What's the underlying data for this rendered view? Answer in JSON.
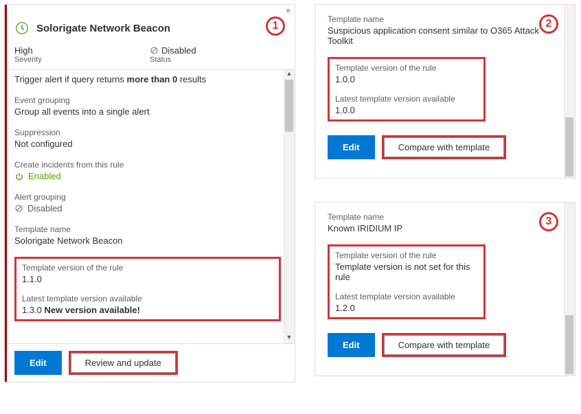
{
  "panel1": {
    "title": "Solorigate Network Beacon",
    "severity_value": "High",
    "severity_label": "Severity",
    "status_value": "Disabled",
    "status_label": "Status",
    "trigger_pre": "Trigger alert if query returns ",
    "trigger_bold": "more than 0",
    "trigger_post": " results",
    "grouping_label": "Event grouping",
    "grouping_value": "Group all events into a single alert",
    "suppression_label": "Suppression",
    "suppression_value": "Not configured",
    "incidents_label": "Create incidents from this rule",
    "incidents_value": "Enabled",
    "alertgrp_label": "Alert grouping",
    "alertgrp_value": "Disabled",
    "tplname_label": "Template name",
    "tplname_value": "Solorigate Network Beacon",
    "tplver_label": "Template version of the rule",
    "tplver_value": "1.1.0",
    "latest_label": "Latest template version available",
    "latest_ver": "1.3.0 ",
    "latest_bold": "New version available!",
    "edit_btn": "Edit",
    "review_btn": "Review and update"
  },
  "panel2": {
    "tplname_label": "Template name",
    "tplname_value": "Suspicious application consent similar to O365 Attack Toolkit",
    "tplver_label": "Template version of the rule",
    "tplver_value": "1.0.0",
    "latest_label": "Latest template version available",
    "latest_value": "1.0.0",
    "edit_btn": "Edit",
    "compare_btn": "Compare with template"
  },
  "panel3": {
    "tplname_label": "Template name",
    "tplname_value": "Known IRIDIUM IP",
    "tplver_label": "Template version of the rule",
    "tplver_value": "Template version is not set for this rule",
    "latest_label": "Latest template version available",
    "latest_value": "1.2.0",
    "edit_btn": "Edit",
    "compare_btn": "Compare with template"
  },
  "badges": {
    "b1": "1",
    "b2": "2",
    "b3": "3"
  }
}
